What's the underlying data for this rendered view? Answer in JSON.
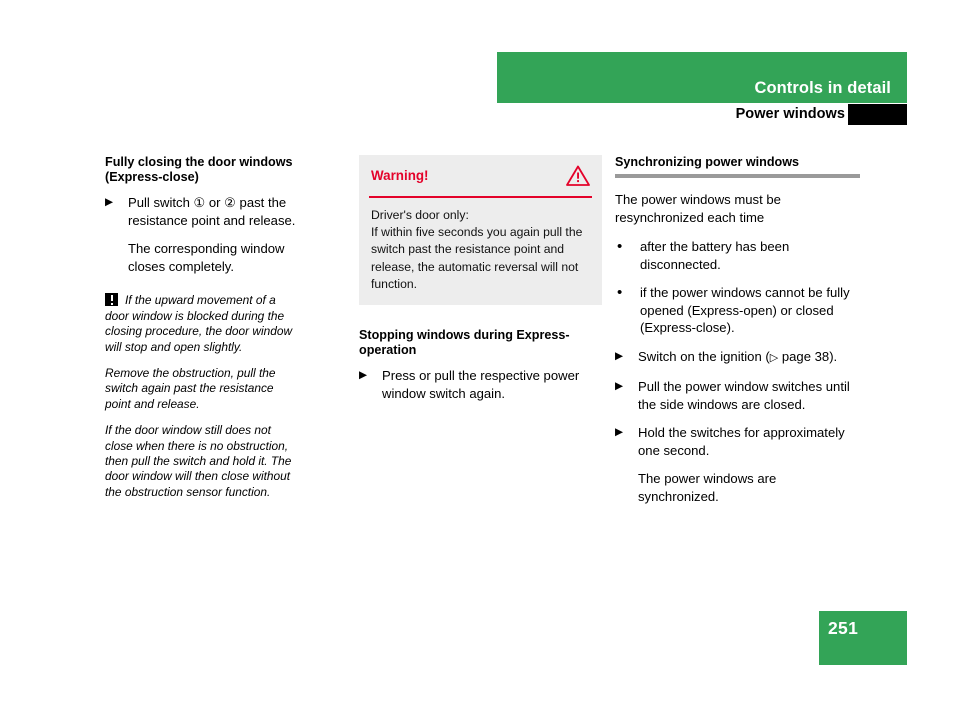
{
  "header": {
    "band_title": "Controls in detail",
    "sub_title": "Power windows",
    "band_color": "#33a457",
    "tab_color": "#000000"
  },
  "column_left": {
    "heading": "Fully closing the door windows (Express-close)",
    "bullet_marker": "▶",
    "step": {
      "text_before": "Pull switch ",
      "circle_1": "①",
      "text_mid": " or ",
      "circle_2": "②",
      "text_after": " past the resistance point and release."
    },
    "result_text": "The corresponding window closes completely.",
    "notes": [
      "If the upward movement of a door window is blocked during the closing procedure, the door window will stop and open slightly.",
      "Remove the obstruction, pull the switch again past the resistance point and release.",
      "If the door window still does not close when there is no obstruction, then pull the switch and hold it. The door window will then close without the obstruction sensor function."
    ],
    "note_icon": "exclamation-box-icon"
  },
  "column_middle": {
    "warning": {
      "title": "Warning!",
      "icon": "warning-triangle-icon",
      "accent_color": "#e4022a",
      "background_color": "#ededed",
      "body": "Driver's door only:\nIf within five seconds you again pull the switch past the resistance point and release, the automatic reversal will not function."
    },
    "heading": "Stopping windows during Express-operation",
    "bullet_marker": "▶",
    "step": "Press or pull the respective power window switch again."
  },
  "column_right": {
    "heading": "Synchronizing power windows",
    "rule_color": "#9a9a9a",
    "intro": "The power windows must be resynchronized each time",
    "dot_marker": "•",
    "conditions": [
      "after the battery has been disconnected.",
      "if the power windows cannot be fully opened (Express-open) or closed (Express-close)."
    ],
    "bullet_marker": "▶",
    "steps": [
      {
        "text_before": "Switch on the ignition (",
        "ref_marker": "▷",
        "ref_text": " page 38",
        "text_after": ")."
      },
      {
        "text_before": "Pull the power window switches until the side windows are closed.",
        "ref_marker": "",
        "ref_text": "",
        "text_after": ""
      },
      {
        "text_before": "Hold the switches for approximately one second.",
        "ref_marker": "",
        "ref_text": "",
        "text_after": ""
      }
    ],
    "result_text": "The power windows are synchronized."
  },
  "footer": {
    "page_number": "251",
    "box_color": "#33a457"
  }
}
